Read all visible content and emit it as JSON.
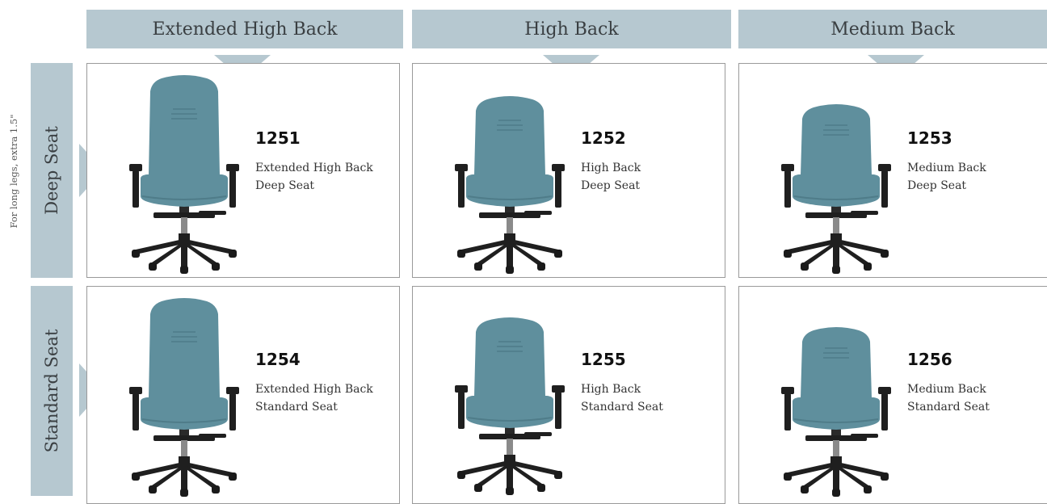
{
  "columns": [
    {
      "label": "Extended High Back"
    },
    {
      "label": "High Back"
    },
    {
      "label": "Medium Back"
    }
  ],
  "rows": [
    {
      "label": "Deep Seat"
    },
    {
      "label": "Standard Seat"
    }
  ],
  "side_note": "For long legs, extra 1.5\"",
  "colors": {
    "header_bg": "#b6c8d0",
    "chair_fabric": "#5f8f9d",
    "chair_frame": "#1f1f1f"
  },
  "cards": [
    {
      "model": "1251",
      "line1": "Extended High Back",
      "line2": "Deep Seat"
    },
    {
      "model": "1252",
      "line1": "High Back",
      "line2": "Deep Seat"
    },
    {
      "model": "1253",
      "line1": "Medium Back",
      "line2": "Deep Seat"
    },
    {
      "model": "1254",
      "line1": "Extended High Back",
      "line2": "Standard Seat"
    },
    {
      "model": "1255",
      "line1": "High Back",
      "line2": "Standard Seat"
    },
    {
      "model": "1256",
      "line1": "Medium Back",
      "line2": "Standard Seat"
    }
  ]
}
